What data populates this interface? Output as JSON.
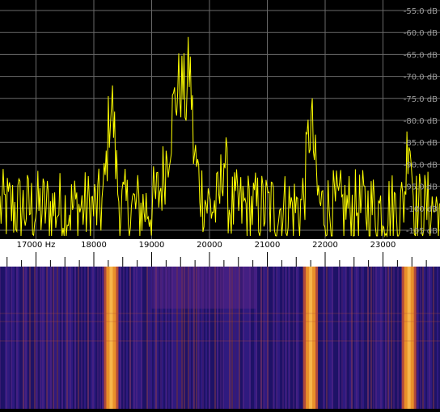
{
  "spectrum": {
    "db_labels": [
      "-55.0 dB",
      "-60.0 dB",
      "-65.0 dB",
      "-70.0 dB",
      "-75.0 dB",
      "-80.0 dB",
      "-85.0 dB",
      "-90.0 dB",
      "-95.0 dB",
      "-100 dB",
      "-105 dB",
      "-110 dB",
      "-115 dB"
    ],
    "db_values": [
      -55,
      -60,
      -65,
      -70,
      -75,
      -80,
      -85,
      -90,
      -95,
      -100,
      -105,
      -110,
      -115
    ],
    "trace_color": "#ffff00",
    "grid_color": "#6a6a6a"
  },
  "freq_axis": {
    "labels": [
      "17000 Hz",
      "18000",
      "19000",
      "20000",
      "21000",
      "22000",
      "23000"
    ],
    "values": [
      17000,
      18000,
      19000,
      20000,
      21000,
      22000,
      23000
    ]
  },
  "waterfall": {
    "signal_bands_hz": [
      18300,
      21750,
      23450
    ],
    "colors": [
      "#1e1268",
      "#3a1f8f",
      "#6a2a8a",
      "#b24a3a",
      "#e8902a",
      "#ffd060"
    ]
  }
}
